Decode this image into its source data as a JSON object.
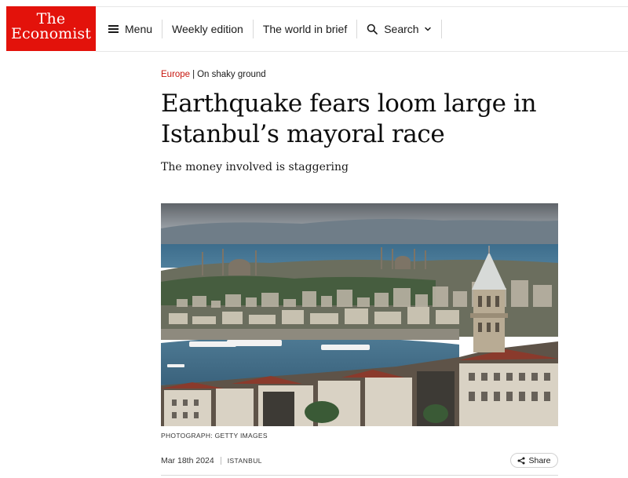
{
  "header": {
    "logo_line1": "The",
    "logo_line2": "Economist",
    "nav": {
      "menu_label": "Menu",
      "weekly_label": "Weekly edition",
      "brief_label": "The world in brief",
      "search_label": "Search"
    },
    "icons": {
      "menu": "hamburger-icon",
      "search": "search-icon",
      "search_dropdown": "chevron-down-icon"
    }
  },
  "article": {
    "section": "Europe",
    "rubric_separator": "|",
    "rubric": "On shaky ground",
    "headline": "Earthquake fears loom large in Istanbul’s mayoral race",
    "subheadline": "The money involved is staggering",
    "image_caption": "PHOTOGRAPH: GETTY IMAGES",
    "date": "Mar 18th 2024",
    "dateline": "ISTANBUL",
    "share_label": "Share"
  },
  "colors": {
    "brand_red": "#e3120b",
    "section_red": "#c7160e"
  }
}
